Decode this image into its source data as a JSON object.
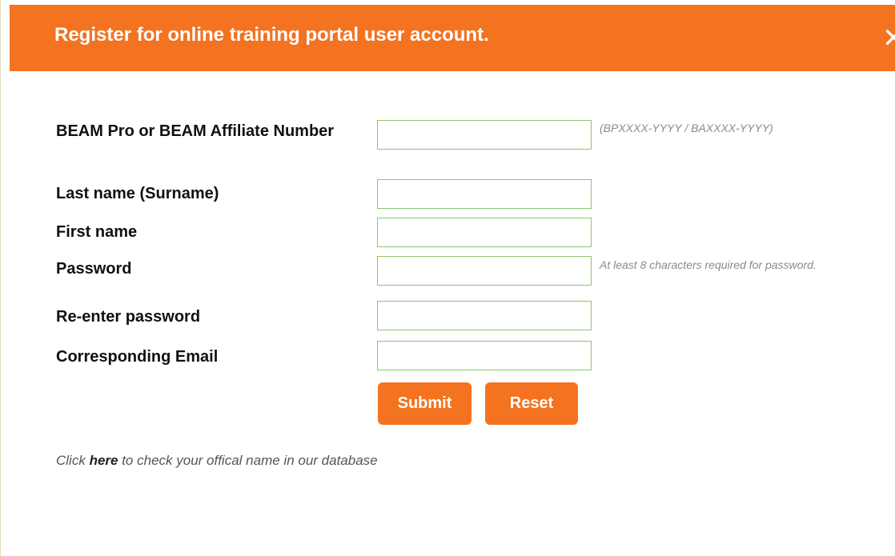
{
  "dialog": {
    "title": "Register for online training portal user account.",
    "close_symbol": "✕"
  },
  "form": {
    "fields": [
      {
        "label": "BEAM Pro or BEAM Affiliate Number",
        "value": "",
        "hint": "(BPXXXX-YYYY / BAXXXX-YYYY)"
      },
      {
        "label": "Last name (Surname)",
        "value": ""
      },
      {
        "label": "First name",
        "value": ""
      },
      {
        "label": "Password",
        "value": "",
        "hint": "At least 8 characters required for password."
      },
      {
        "label": "Re-enter password",
        "value": ""
      },
      {
        "label": "Corresponding Email",
        "value": ""
      }
    ],
    "submit_label": "Submit",
    "reset_label": "Reset"
  },
  "footer": {
    "prefix": "Click ",
    "link_text": "here",
    "suffix": " to check your offical name in our database"
  },
  "colors": {
    "accent": "#f37321",
    "field_border": "#8cc86c",
    "hint_text": "#8a8a8a"
  }
}
